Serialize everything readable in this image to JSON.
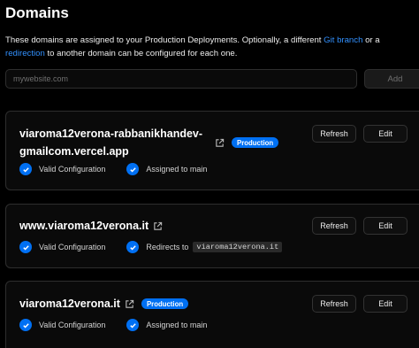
{
  "header": {
    "title": "Domains",
    "description": {
      "part1": "These domains are assigned to your Production Deployments. Optionally, a different ",
      "link1": "Git branch",
      "part2": " or a ",
      "link2": "redirection",
      "part3": " to another domain can be configured for each one."
    }
  },
  "add_domain": {
    "placeholder": "mywebsite.com",
    "add_label": "Add"
  },
  "domains": [
    {
      "name_line1": "viaroma12verona-rabbanikhandev-",
      "name_line2": "gmailcom.vercel.app",
      "badge": "Production",
      "status1": "Valid Configuration",
      "status2": "Assigned to main",
      "refresh_label": "Refresh",
      "edit_label": "Edit"
    },
    {
      "name": "www.viaroma12verona.it",
      "status1": "Valid Configuration",
      "status2_prefix": "Redirects to",
      "status2_target": "viaroma12verona.it",
      "refresh_label": "Refresh",
      "edit_label": "Edit"
    },
    {
      "name": "viaroma12verona.it",
      "badge": "Production",
      "status1": "Valid Configuration",
      "status2": "Assigned to main",
      "refresh_label": "Refresh",
      "edit_label": "Edit"
    }
  ],
  "colors": {
    "accent": "#0070f3",
    "link": "#3291ff",
    "background": "#000000",
    "card_border": "#2e2e2e"
  },
  "icons": {
    "external_link": "external-link-icon",
    "check": "check-circle-icon"
  }
}
